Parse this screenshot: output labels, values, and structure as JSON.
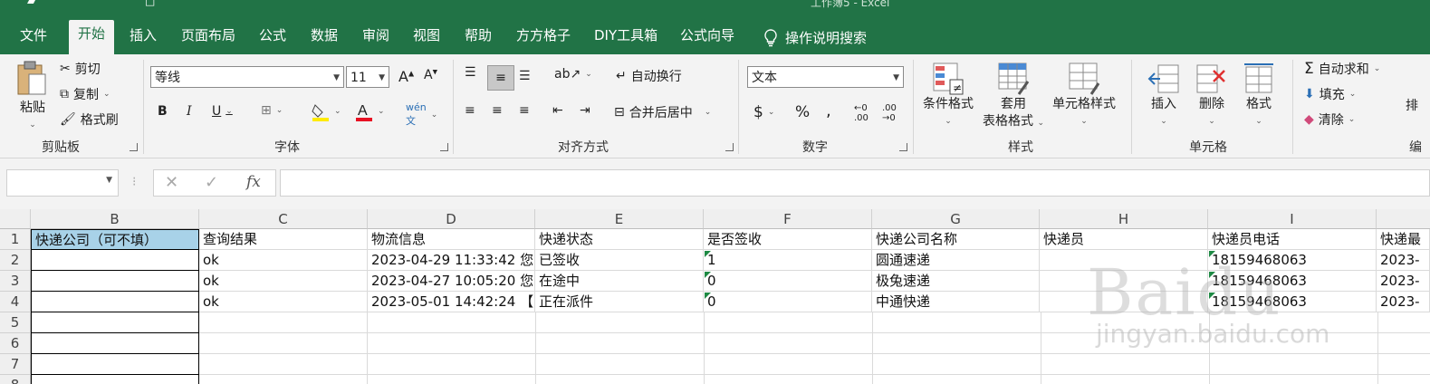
{
  "window": {
    "title": "工作簿5 - Excel"
  },
  "tabs": [
    "文件",
    "开始",
    "插入",
    "页面布局",
    "公式",
    "数据",
    "审阅",
    "视图",
    "帮助",
    "方方格子",
    "DIY工具箱",
    "公式向导"
  ],
  "tell_me": "操作说明搜索",
  "ribbon": {
    "clipboard": {
      "paste": "粘贴",
      "cut": "剪切",
      "copy": "复制",
      "format_painter": "格式刷",
      "label": "剪贴板"
    },
    "font": {
      "name": "等线",
      "size": "11",
      "label": "字体"
    },
    "alignment": {
      "wrap": "自动换行",
      "merge": "合并后居中",
      "label": "对齐方式"
    },
    "number": {
      "format": "文本",
      "label": "数字"
    },
    "styles": {
      "conditional": "条件格式",
      "table_line1": "套用",
      "table_line2": "表格格式",
      "cell_styles": "单元格样式",
      "label": "样式"
    },
    "cells": {
      "insert": "插入",
      "delete": "删除",
      "format": "格式",
      "label": "单元格"
    },
    "editing": {
      "autosum": "自动求和",
      "fill": "填充",
      "clear": "清除",
      "label": "编"
    }
  },
  "columns": [
    "B",
    "C",
    "D",
    "E",
    "F",
    "G",
    "H",
    "I"
  ],
  "rows": [
    "1",
    "2",
    "3",
    "4",
    "5",
    "6",
    "7",
    "8"
  ],
  "sheet": {
    "header": [
      "快递公司（可不填）",
      "查询结果",
      "物流信息",
      "快递状态",
      "是否签收",
      "快递公司名称",
      "快递员",
      "快递员电话",
      "快递最"
    ],
    "r2": [
      "",
      "ok",
      "2023-04-29 11:33:42 您",
      "已签收",
      "1",
      "圆通速递",
      "",
      "18159468063",
      "2023-"
    ],
    "r3": [
      "",
      "ok",
      "2023-04-27 10:05:20 您",
      "在途中",
      "0",
      "极兔速递",
      "",
      "18159468063",
      "2023-"
    ],
    "r4": [
      "",
      "ok",
      "2023-05-01 14:42:24 【",
      "正在派件",
      "0",
      "中通快递",
      "",
      "18159468063",
      "2023-"
    ]
  },
  "watermark": {
    "brand": "Baidu",
    "sub": "jingyan.baidu.com"
  },
  "colors": {
    "accent": "#217346",
    "selected_header": "#a8d2e8"
  }
}
